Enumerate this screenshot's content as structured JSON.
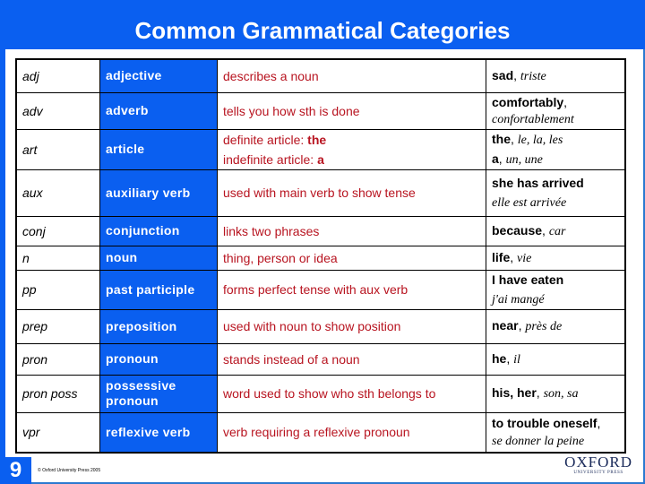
{
  "slide": {
    "title": "Common Grammatical Categories",
    "page_number": "9",
    "copyright": "© Oxford University Press 2005",
    "logo": {
      "line1": "OXFORD",
      "line2": "UNIVERSITY PRESS"
    }
  },
  "colors": {
    "brand_blue": "#0a5ff0",
    "definition_red": "#b81420"
  },
  "rows": [
    {
      "abbr": "adj",
      "term": "adjective",
      "desc": "describes a noun",
      "ex_en": "sad",
      "ex_sep": ", ",
      "ex_fr": "triste"
    },
    {
      "abbr": "adv",
      "term": "adverb",
      "desc": "tells you how sth is done",
      "ex_en": "comfortably",
      "ex_sep": ",",
      "ex_fr": "confortablement"
    },
    {
      "abbr": "art",
      "term": "article",
      "desc_line1_label": "definite article: ",
      "desc_line1_value": "the",
      "desc_line2_label": "indefinite article: ",
      "desc_line2_value": "a",
      "ex1_en": "the",
      "ex1_fr": "le, la, les",
      "ex2_en": "a",
      "ex2_fr": "un, une",
      "ex_sep": ", "
    },
    {
      "abbr": "aux",
      "term": "auxiliary verb",
      "desc": "used with main verb to show tense",
      "ex_en": "she has arrived",
      "ex_fr": "elle est arrivée"
    },
    {
      "abbr": "conj",
      "term": "conjunction",
      "desc": "links two phrases",
      "ex_en": "because",
      "ex_sep": ", ",
      "ex_fr": "car"
    },
    {
      "abbr": "n",
      "term": "noun",
      "desc": "thing, person or idea",
      "ex_en": "life",
      "ex_sep": ", ",
      "ex_fr": "vie"
    },
    {
      "abbr": "pp",
      "term": "past participle",
      "desc": "forms perfect tense with aux verb",
      "ex_en": "I have eaten",
      "ex_fr": "j'ai mangé"
    },
    {
      "abbr": "prep",
      "term": "preposition",
      "desc": "used with noun to show position",
      "ex_en": "near",
      "ex_sep": ", ",
      "ex_fr": "près de"
    },
    {
      "abbr": "pron",
      "term": "pronoun",
      "desc": "stands instead of a noun",
      "ex_en": "he",
      "ex_sep": ", ",
      "ex_fr": "il"
    },
    {
      "abbr": "pron poss",
      "term": "possessive pronoun",
      "desc": "word used to show who sth belongs to",
      "ex_en": "his, her",
      "ex_sep": ", ",
      "ex_fr": "son, sa"
    },
    {
      "abbr": "vpr",
      "term": "reflexive verb",
      "desc": "verb requiring a reflexive pronoun",
      "ex_en": "to trouble oneself",
      "ex_sep": ",",
      "ex_fr": "se donner la peine"
    }
  ]
}
